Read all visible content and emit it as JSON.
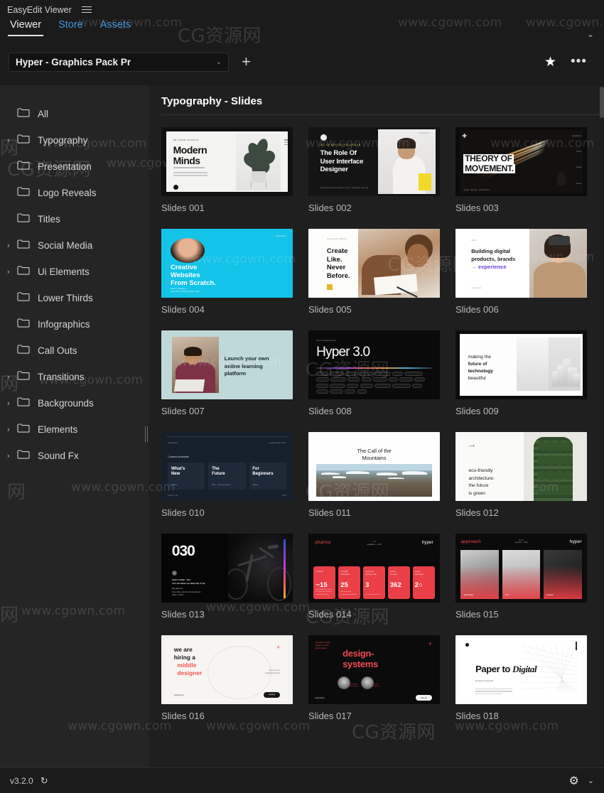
{
  "app": {
    "title": "EasyEdit Viewer",
    "menu_icon": "hamburger-icon"
  },
  "tabs": [
    {
      "label": "Viewer",
      "active": true
    },
    {
      "label": "Store",
      "active": false
    },
    {
      "label": "Assets",
      "active": false
    }
  ],
  "preset": {
    "value": "Hyper - Graphics Pack Pr",
    "caret": "⌄",
    "add_label": "+",
    "favorite_icon": "★",
    "more_icon": "•••"
  },
  "sidebar": {
    "items": [
      {
        "label": "All",
        "expandable": false
      },
      {
        "label": "Typography",
        "expandable": true
      },
      {
        "label": "Presentation",
        "expandable": false
      },
      {
        "label": "Logo Reveals",
        "expandable": false
      },
      {
        "label": "Titles",
        "expandable": false
      },
      {
        "label": "Social Media",
        "expandable": true
      },
      {
        "label": "Ui Elements",
        "expandable": true
      },
      {
        "label": "Lower Thirds",
        "expandable": false
      },
      {
        "label": "Infographics",
        "expandable": false
      },
      {
        "label": "Call Outs",
        "expandable": false
      },
      {
        "label": "Transitions",
        "expandable": true
      },
      {
        "label": "Backgrounds",
        "expandable": true
      },
      {
        "label": "Elements",
        "expandable": true
      },
      {
        "label": "Sound Fx",
        "expandable": true
      }
    ]
  },
  "content": {
    "heading": "Typography - Slides",
    "items": [
      {
        "caption": "Slides 001",
        "title": "Modern Minds",
        "kicker": "BE MORE MINDFUL",
        "body": "Different creative workshops, images, changes and planned lessons."
      },
      {
        "caption": "Slides 002",
        "title": "The Role Of User Interface Designer",
        "kicker": "UI / UX DESIGN DISCUSSION",
        "footer": "easyedit.pro  delivers talent  tools  ux  navigation  agenda",
        "corner": "easyedit.pro"
      },
      {
        "caption": "Slides 003",
        "title": "THEORY OF MOVEMENT.",
        "footer": "Speed • Energy • Acceleration",
        "menu": [
          "easyedit.pro",
          "motion",
          "energy",
          "access"
        ]
      },
      {
        "caption": "Slides 004",
        "title": "Creative Websites From Scratch.",
        "footer": "Sarah J. Williams\nLead UX and Web Design Coach",
        "corner": "easyedit.pro"
      },
      {
        "caption": "Slides 005",
        "title": "Create Like. Never Before.",
        "kicker": "Case Study Collection"
      },
      {
        "caption": "Slides 006",
        "title": "Building digital products, brands",
        "accent_line": "→ experience",
        "kicker": "2024",
        "footer": "easyedit.pro"
      },
      {
        "caption": "Slides 007",
        "title": "Launch your own online learning platform"
      },
      {
        "caption": "Slides 008",
        "title": "Hyper 3.0",
        "kicker": "Scroll To Value Pack Pr"
      },
      {
        "caption": "Slides 009",
        "title": "making the future of technology beautiful"
      },
      {
        "caption": "Slides 010",
        "kicker": "Curated schedules",
        "cards": [
          {
            "title": "What's New",
            "meta": "Updates"
          },
          {
            "title": "The Future",
            "meta": "2024 — New Generation"
          },
          {
            "title": "For Beginners",
            "meta": "Starters"
          }
        ],
        "top_left": "easyedit.pro",
        "top_right": "creative design studio",
        "bottom_left": "report 1 / 04",
        "bottom_right": "2024"
      },
      {
        "caption": "Slides 011",
        "title": "The Call of the Mountains"
      },
      {
        "caption": "Slides 012",
        "title": "eco-friendly architecture: the future is green",
        "arrow": "⟶"
      },
      {
        "caption": "Slides 013",
        "number": "030",
        "credit_1": "EASY LIVING ´ 030\nI Am Not What You Want Me To Be",
        "credit_2": "EasyEdit.Pro\nFrom Mono Vectors Pixels Sheets´\n(2012—2027)"
      },
      {
        "caption": "Slides 014",
        "brand_left": "pharma",
        "brand_right": "hyper",
        "center": "v 1.0\ninstallation — 2024",
        "stats": [
          {
            "label": "analysis",
            "value": "~15",
            "note": "Daily health focused for the brand framework in medical care billing"
          },
          {
            "label": "in-depth interviews",
            "value": "25",
            "note": "who works with comparative in industry"
          },
          {
            "label": "customer journey map",
            "value": "3",
            "note": "fits for day, now one"
          },
          {
            "label": "online surveys",
            "value": "362",
            "note": ""
          },
          {
            "label": "visual landmark",
            "value": "2○",
            "note": ""
          }
        ]
      },
      {
        "caption": "Slides 015",
        "brand_left": "approach",
        "brand_right": "hyper",
        "center": "No. 03\ncollection — 2024",
        "panels": [
          "technology",
          "form",
          "emotion"
        ]
      },
      {
        "caption": "Slides 016",
        "title_1": "we are",
        "title_2": "hiring a",
        "accent_1": "middle",
        "accent_2": "designer",
        "cv": "send your cv\n→ hr@easyedit.pro",
        "brand": "easyedit.pro",
        "pill": "vacancy",
        "plus": "+"
      },
      {
        "caption": "Slides 017",
        "kicker": "easyedit.pro studio\naugust 11, 18:00\nonline meetup",
        "title_1": "design-",
        "title_2": "systems",
        "brand": "easyedit.pro",
        "pill": "meet-up",
        "plus": "+",
        "speakers": [
          "nadia morgan\nproduct design",
          "alex reed\ndesign lead"
        ]
      },
      {
        "caption": "Slides 018",
        "title_main": "Paper to ",
        "title_italic": "Digital",
        "label": "the future of documents"
      }
    ]
  },
  "footer": {
    "version": "v3.2.0",
    "refresh_icon": "↻",
    "settings_icon": "gear-icon",
    "caret_icon": "⌄"
  },
  "watermarks": [
    "www.cgown.com",
    "CG资源网",
    "资源网",
    "网"
  ]
}
